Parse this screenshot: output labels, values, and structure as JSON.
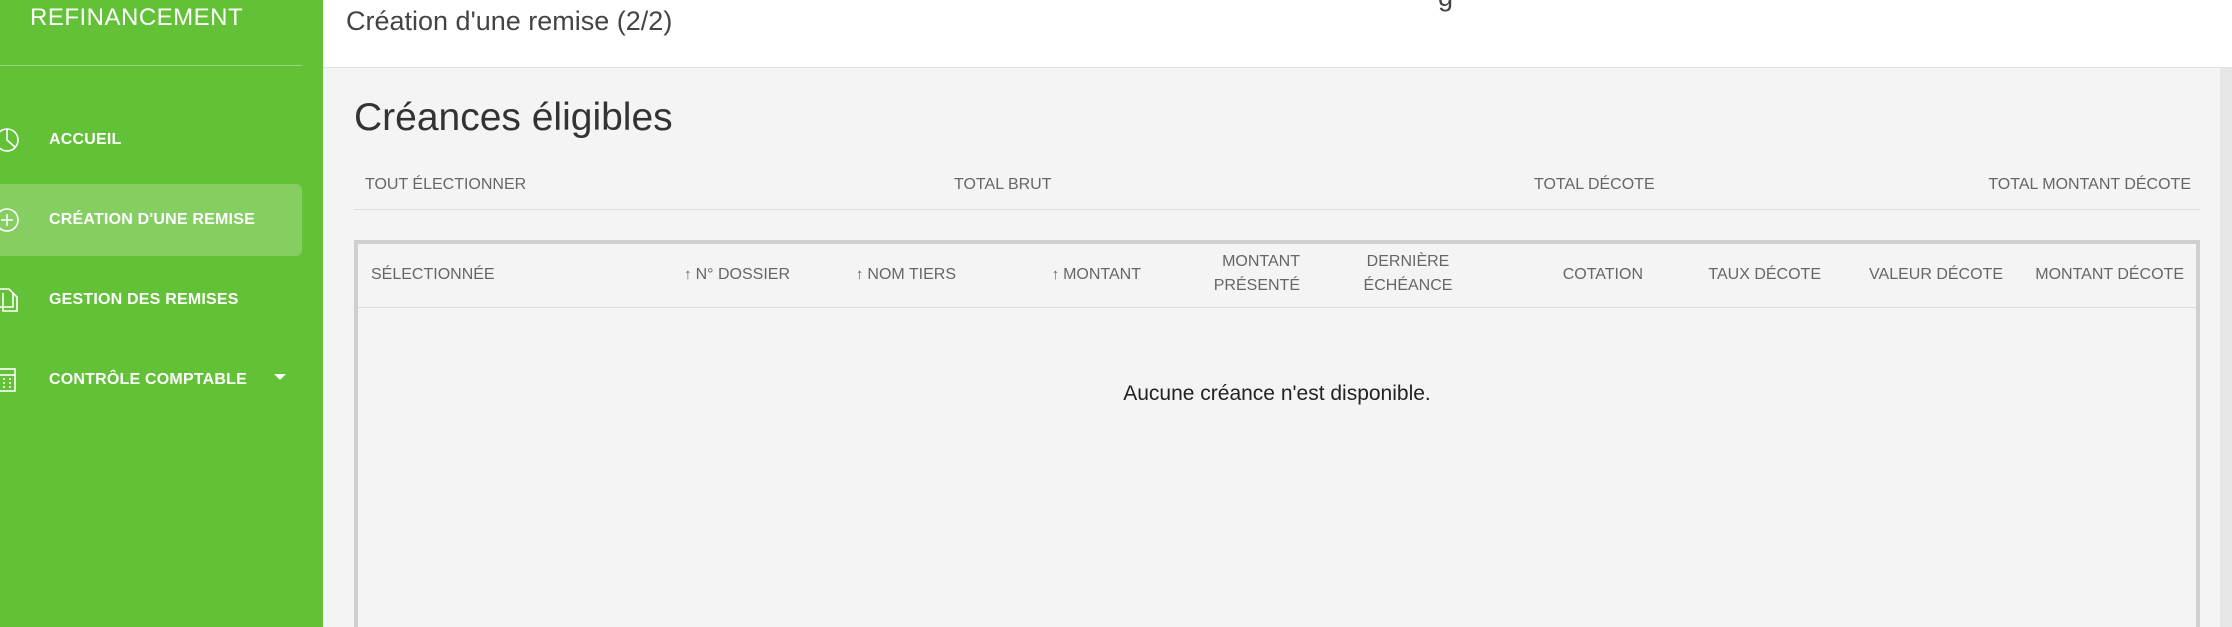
{
  "sidebar": {
    "brand": "REFINANCEMENT",
    "items": [
      {
        "label": "ACCUEIL",
        "icon": "pie-chart-icon"
      },
      {
        "label": "CRÉATION D'UNE REMISE",
        "icon": "plus-circle-icon",
        "active": true
      },
      {
        "label": "GESTION DES REMISES",
        "icon": "documents-icon"
      },
      {
        "label": "CONTRÔLE COMPTABLE",
        "icon": "calculator-icon",
        "has_dropdown": true
      }
    ],
    "color": "#62c136"
  },
  "topbar": {
    "title": "Création d'une remise (2/2)",
    "cut_text": "g"
  },
  "main": {
    "section_title": "Créances éligibles",
    "summary": {
      "select_all": "TOUT ÉLECTIONNER",
      "total_brut": "TOTAL BRUT",
      "total_decote": "TOTAL DÉCOTE",
      "total_montant_decote": "TOTAL MONTANT DÉCOTE"
    },
    "table": {
      "columns": [
        {
          "label": "SÉLECTIONNÉE",
          "sortable": false
        },
        {
          "label": "N° DOSSIER",
          "sortable": true
        },
        {
          "label": "NOM TIERS",
          "sortable": true
        },
        {
          "label": "MONTANT",
          "sortable": true
        },
        {
          "label": "MONTANT",
          "label2": "PRÉSENTÉ",
          "sortable": false
        },
        {
          "label": "DERNIÈRE",
          "label2": "ÉCHÉANCE",
          "sortable": false
        },
        {
          "label": "COTATION",
          "sortable": false
        },
        {
          "label": "TAUX DÉCOTE",
          "sortable": false
        },
        {
          "label": "VALEUR DÉCOTE",
          "sortable": false
        },
        {
          "label": "MONTANT DÉCOTE",
          "sortable": false
        }
      ],
      "sort_arrow": "↑",
      "empty_message": "Aucune créance n'est disponible."
    }
  }
}
